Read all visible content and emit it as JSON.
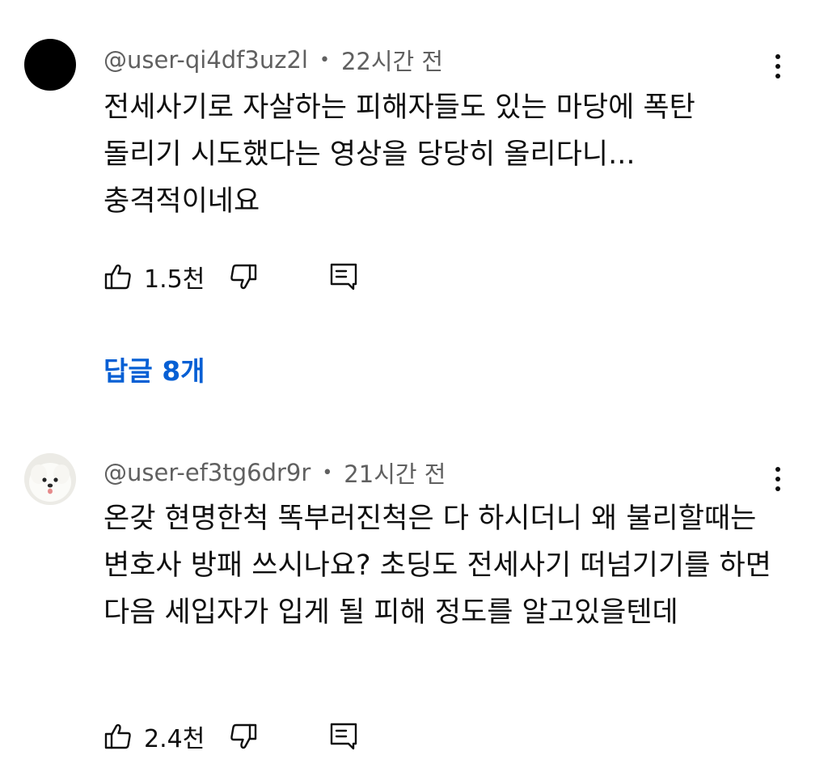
{
  "comments": [
    {
      "author": "@user-qi4df3uz2l",
      "separator": "•",
      "time": "22시간 전",
      "text": "전세사기로 자살하는 피해자들도 있는 마당에 폭탄 돌리기 시도했다는 영상을 당당히 올리다니... 충격적이네요",
      "likes": "1.5천",
      "avatar": "solid-black-avatar",
      "replies_label": "답글 8개"
    },
    {
      "author": "@user-ef3tg6dr9r",
      "separator": "•",
      "time": "21시간 전",
      "text": "온갖 현명한척 똑부러진척은 다 하시더니 왜 불리할때는 변호사 방패 쓰시나요? 초딩도 전세사기 떠넘기기를 하면 다음 세입자가 입게 될 피해 정도를 알고있을텐데",
      "likes": "2.4천",
      "avatar": "white-dog-avatar"
    }
  ],
  "icons": {
    "like": "thumbs-up-icon",
    "dislike": "thumbs-down-icon",
    "reply": "reply-comment-icon",
    "more": "more-vertical-icon"
  },
  "colors": {
    "link": "#065fd4",
    "meta": "#606060",
    "text": "#0f0f0f"
  }
}
